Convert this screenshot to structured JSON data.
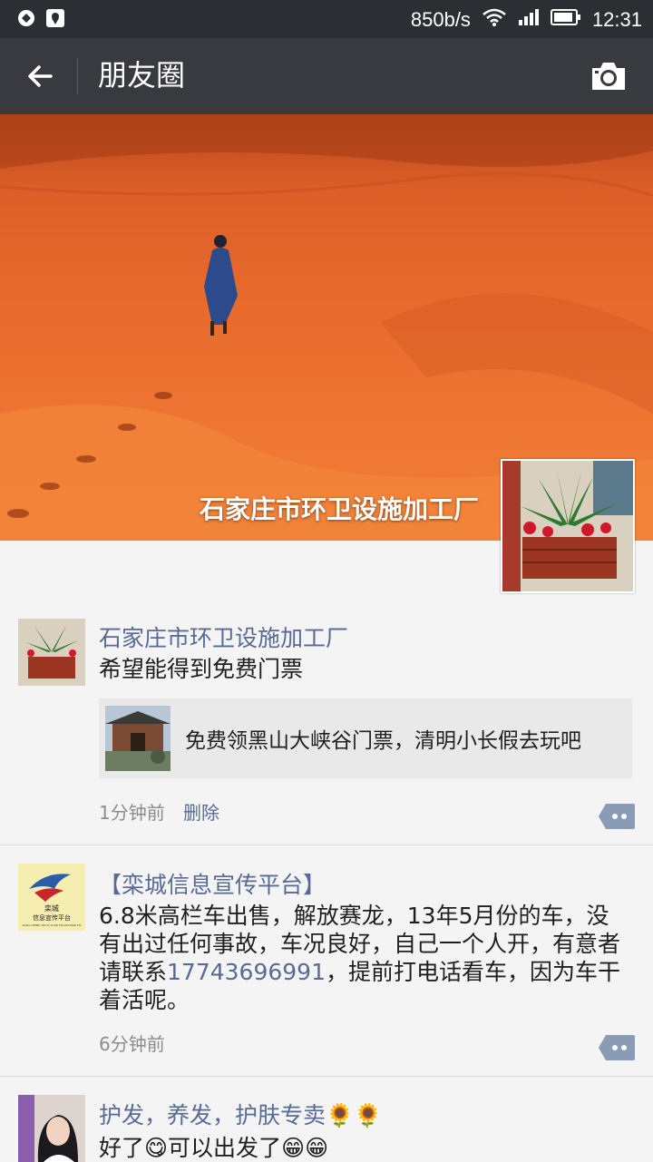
{
  "status_bar": {
    "network_speed": "850b/s",
    "time": "12:31",
    "icons": [
      "vpn-icon",
      "location-icon",
      "wifi-icon",
      "signal-icon",
      "battery-icon"
    ]
  },
  "nav": {
    "title": "朋友圈",
    "back_icon": "back-arrow-icon",
    "camera_icon": "camera-icon"
  },
  "cover": {
    "user_name": "石家庄市环卫设施加工厂"
  },
  "posts": [
    {
      "name": "石家庄市环卫设施加工厂",
      "text": "希望能得到免费门票",
      "share": {
        "title": "免费领黑山大峡谷门票，清明小长假去玩吧"
      },
      "time": "1分钟前",
      "delete_label": "删除"
    },
    {
      "name": "【栾城信息宣传平台】",
      "text_before_phone": "6.8米高栏车出售，解放赛龙，13年5月份的车，没有出过任何事故，车况良好，自己一个人开，有意者请联系",
      "phone": "17743696991",
      "text_after_phone": "，提前打电话看车，因为车干着活呢。",
      "avatar_text": "栾城 信息宣传平台",
      "avatar_subtext": "LUAN CHENG XIN XI XUAN CHUAN PING TAI",
      "time": "6分钟前"
    },
    {
      "name": "护发，养发，护肤专卖🌻🌻",
      "text": "好了😋可以出发了😁😁"
    }
  ],
  "colors": {
    "link": "#576b95",
    "nav_bg": "#393a3f",
    "status_bg": "#2b2e33",
    "page_bg": "#f4f4f4"
  }
}
